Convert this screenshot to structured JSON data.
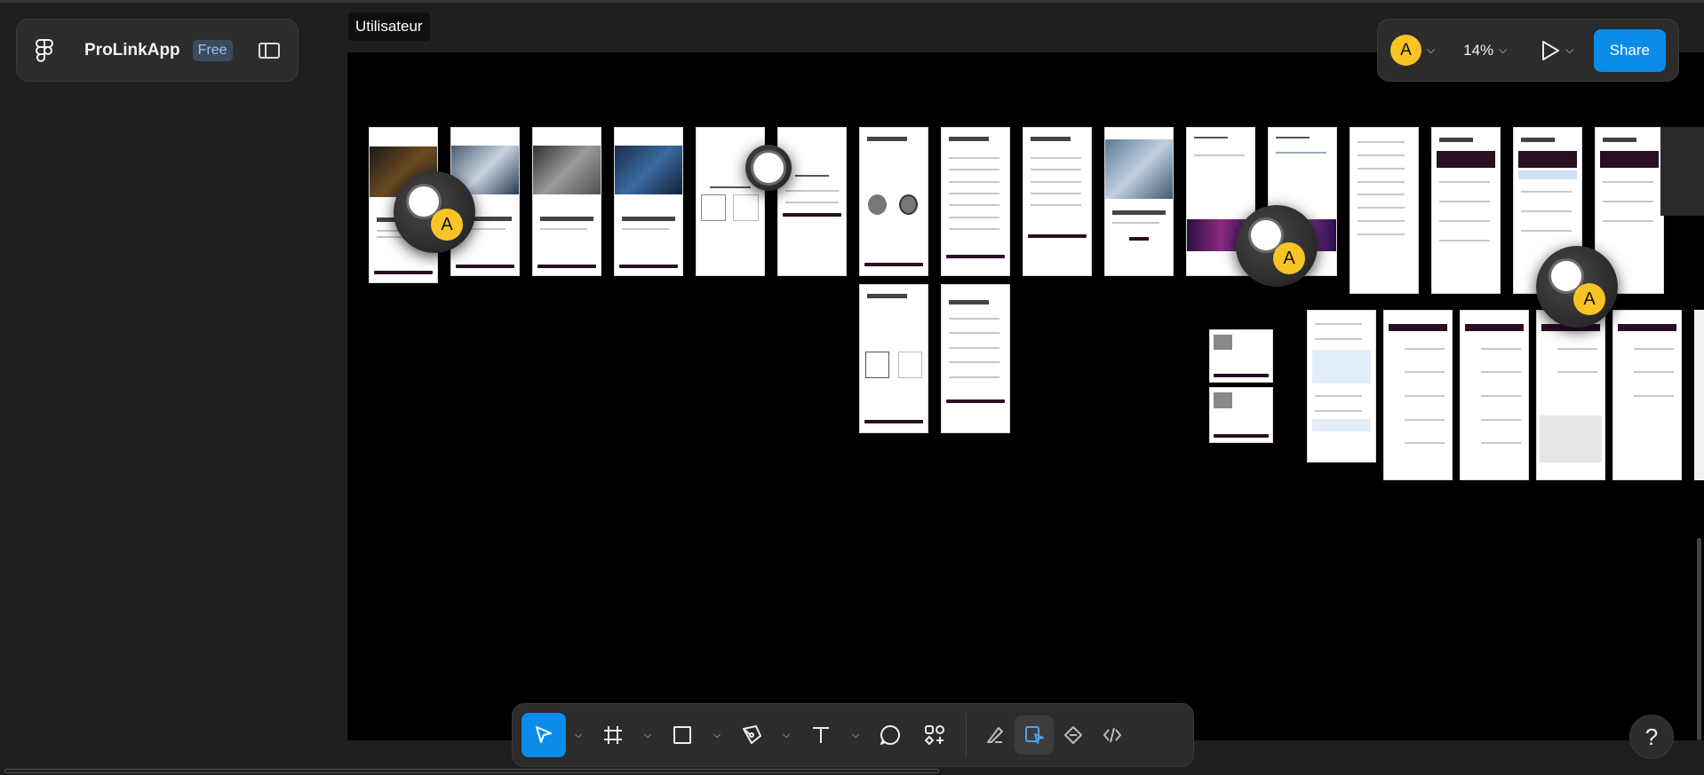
{
  "file": {
    "name": "ProLinkApp",
    "plan": "Free"
  },
  "canvas": {
    "frame_label": "Utilisateur"
  },
  "collaborator": {
    "initial": "A",
    "color": "#f7c325"
  },
  "view": {
    "zoom": "14%"
  },
  "share": {
    "label": "Share"
  },
  "accent": "#0c8ce9",
  "tools": [
    {
      "name": "move-tool",
      "icon": "cursor-icon",
      "active": true
    },
    {
      "name": "frame-tool",
      "icon": "frame-icon"
    },
    {
      "name": "shape-tool",
      "icon": "rectangle-icon"
    },
    {
      "name": "pen-tool",
      "icon": "pen-icon"
    },
    {
      "name": "text-tool",
      "icon": "text-icon"
    },
    {
      "name": "comment-tool",
      "icon": "comment-icon"
    },
    {
      "name": "resources-tool",
      "icon": "components-icon"
    }
  ],
  "modes": [
    {
      "name": "draw-mode",
      "icon": "draw-icon"
    },
    {
      "name": "design-mode",
      "icon": "design-icon",
      "active": true
    },
    {
      "name": "prototype-mode",
      "icon": "prototype-icon"
    },
    {
      "name": "dev-mode",
      "icon": "code-icon"
    }
  ],
  "help": {
    "label": "?"
  }
}
